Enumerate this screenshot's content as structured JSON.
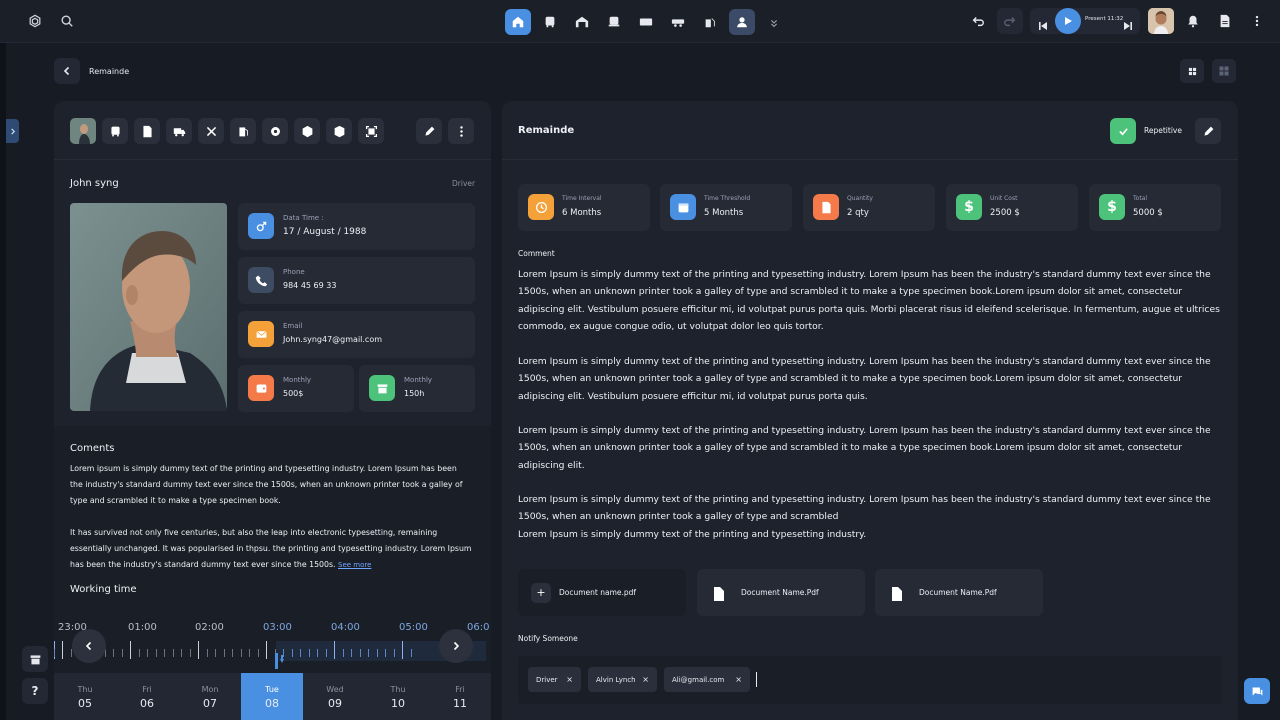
{
  "topbar": {
    "player_label": "Present 11:32"
  },
  "page": {
    "back_title": "Remainde"
  },
  "profile": {
    "name": "John syng",
    "role": "Driver",
    "date_label": "Data Time :",
    "date_value": "17 / August / 1988",
    "phone_label": "Phone",
    "phone_value": "984 45 69 33",
    "email_label": "Email",
    "email_value": "John.syng47@gmail.com",
    "monthly1_label": "Monthly",
    "monthly1_value": "500$",
    "monthly2_label": "Monthly",
    "monthly2_value": "150h"
  },
  "comments": {
    "title": "Coments",
    "p1": "Lorem ipsum is simply dummy text of the printing and typesetting industry. Lorem Ipsum has been the industry's standard dummy text ever since the 1500s, when an unknown printer took a galley of type and scrambled it to make a type specimen book.",
    "p2": "It has survived not only five centuries, but also the leap into electronic typesetting, remaining essentially unchanged. It was popularised in thpsu. the printing and typesetting industry. Lorem Ipsum has been the industry's standard dummy text ever since the 1500s.",
    "see_more": "See more"
  },
  "working": {
    "title": "Working time",
    "times": [
      "23:00",
      "01:00",
      "02:00",
      "03:00",
      "04:00",
      "05:00",
      "06:0"
    ],
    "days": [
      {
        "name": "Thu",
        "num": "05"
      },
      {
        "name": "Fri",
        "num": "06"
      },
      {
        "name": "Mon",
        "num": "07"
      },
      {
        "name": "Tue",
        "num": "08"
      },
      {
        "name": "Wed",
        "num": "09"
      },
      {
        "name": "Thu",
        "num": "10"
      },
      {
        "name": "Fri",
        "num": "11"
      }
    ],
    "active_day": 3
  },
  "remainder": {
    "title": "Remainde",
    "repetitive_label": "Repetitive",
    "stats": [
      {
        "label": "Time Interval",
        "value": "6 Months"
      },
      {
        "label": "Time Threshold",
        "value": "5 Months"
      },
      {
        "label": "Quantity",
        "value": "2 qty"
      },
      {
        "label": "Unit Cost",
        "value": "2500 $"
      },
      {
        "label": "Total",
        "value": "5000 $"
      }
    ],
    "comment_label": "Comment",
    "comment_p1": "Lorem Ipsum is simply dummy text of the printing and typesetting industry. Lorem Ipsum has been the industry's standard dummy text ever since the 1500s, when an unknown printer took a galley of type and scrambled it to make a type specimen book.Lorem ipsum dolor sit amet, consectetur adipiscing elit. Vestibulum posuere efficitur mi, id volutpat purus porta quis. Morbi placerat risus id eleifend scelerisque. In fermentum, augue et ultrices commodo, ex augue congue odio, ut volutpat dolor leo quis tortor.",
    "comment_p2": "Lorem Ipsum is simply dummy text of the printing and typesetting industry. Lorem Ipsum has been the industry's  standard dummy text ever since the 1500s, when an unknown printer took a galley of type and scrambled it to make a type specimen book.Lorem ipsum dolor sit amet, consectetur adipiscing elit. Vestibulum posuere efficitur mi, id volutpat purus porta quis.",
    "comment_p3": "Lorem Ipsum is simply dummy text of the printing and typesetting industry. Lorem Ipsum has been the industry's standard dummy text ever since the 1500s, when an unknown printer took a galley of type and scrambled it to make a type specimen book.Lorem ipsum dolor sit amet, consectetur adipiscing elit.",
    "comment_p4": "Lorem Ipsum is simply dummy text of the printing and typesetting industry. Lorem Ipsum has been the industry's  standard dummy text ever since the 1500s, when an unknown printer took a galley of type and scrambled",
    "comment_p5": "Lorem Ipsum is simply dummy text of the printing and typesetting industry.",
    "documents": [
      "Document name.pdf",
      "Document Name.Pdf",
      "Document Name.Pdf"
    ],
    "notify_label": "Notify Someone",
    "chips": [
      "Driver",
      "Alvin Lynch",
      "Ali@gmail.com"
    ]
  },
  "colors": {
    "accent": "#4a90e2",
    "orange": "#f4a13a",
    "green": "#4cc27a",
    "coral": "#f57a4a"
  }
}
